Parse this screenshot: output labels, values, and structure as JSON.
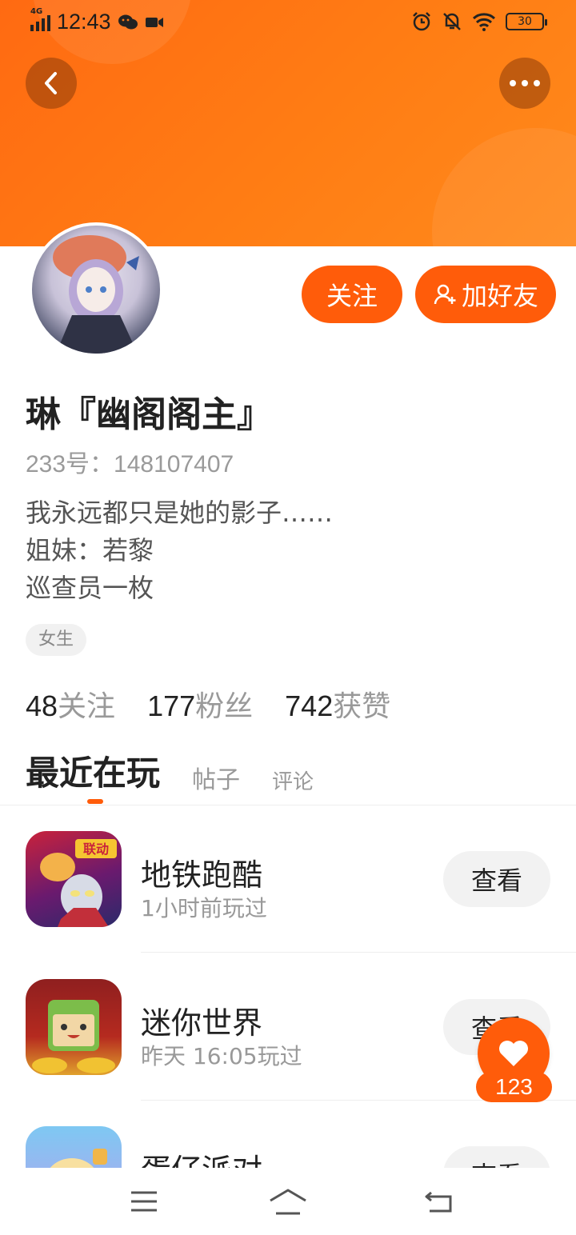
{
  "status_bar": {
    "network": "4G",
    "time": "12:43",
    "battery": "30"
  },
  "profile": {
    "name": "琳『幽阁阁主』",
    "uid": "233号：148107407",
    "bio": [
      "我永远都只是她的影子……",
      "姐妹：若黎",
      "巡查员一枚"
    ],
    "tag": "女生",
    "follow_label": "关注",
    "add_friend_label": "加好友"
  },
  "stats": [
    {
      "value": "48",
      "label": "关注"
    },
    {
      "value": "177",
      "label": "粉丝"
    },
    {
      "value": "742",
      "label": "获赞"
    }
  ],
  "tabs": [
    "最近在玩",
    "帖子",
    "评论"
  ],
  "games": [
    {
      "name": "地铁跑酷",
      "time": "1小时前玩过",
      "button": "查看",
      "badge": "联动"
    },
    {
      "name": "迷你世界",
      "time": "昨天 16:05玩过",
      "button": "查看"
    },
    {
      "name": "蛋仔派对",
      "time": "",
      "button": "查看"
    }
  ],
  "like": {
    "count": "123"
  },
  "colors": {
    "accent": "#ff5c0a",
    "header": "#ff7a14"
  }
}
